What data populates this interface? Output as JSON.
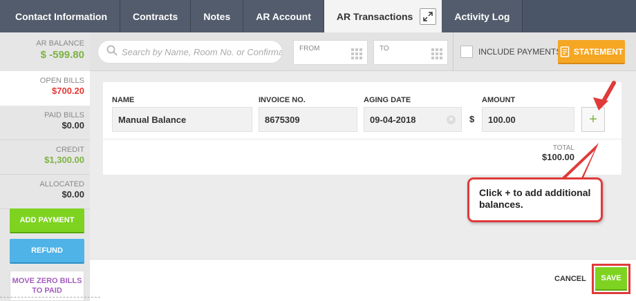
{
  "tabs": [
    {
      "label": "Contact Information"
    },
    {
      "label": "Contracts"
    },
    {
      "label": "Notes"
    },
    {
      "label": "AR Account"
    },
    {
      "label": "AR Transactions"
    },
    {
      "label": "Activity Log"
    }
  ],
  "sidebar": {
    "ar_balance_label": "AR BALANCE",
    "ar_balance_value": "$ -599.80",
    "stats": [
      {
        "label": "OPEN BILLS",
        "value": "$700.20"
      },
      {
        "label": "PAID BILLS",
        "value": "$0.00"
      },
      {
        "label": "CREDIT",
        "value": "$1,300.00"
      },
      {
        "label": "ALLOCATED",
        "value": "$0.00"
      }
    ],
    "add_payment_label": "ADD PAYMENT",
    "refund_label": "REFUND",
    "move_zero_label": "MOVE ZERO BILLS TO PAID"
  },
  "filters": {
    "search_placeholder": "Search by Name, Room No. or Confirma",
    "from_label": "FROM",
    "to_label": "TO",
    "include_payments_label": "INCLUDE PAYMENTS",
    "statement_label": "STATEMENT"
  },
  "entry": {
    "name_header": "NAME",
    "invoice_header": "INVOICE NO.",
    "aging_header": "AGING DATE",
    "amount_header": "AMOUNT",
    "name_value": "Manual Balance",
    "invoice_value": "8675309",
    "aging_value": "09-04-2018",
    "currency_symbol": "$",
    "amount_value": "100.00",
    "add_symbol": "+",
    "total_label": "TOTAL",
    "total_value": "$100.00"
  },
  "callout": {
    "text": "Click + to add additional balances."
  },
  "footer": {
    "cancel_label": "CANCEL",
    "save_label": "SAVE"
  },
  "colors": {
    "tab_bar": "#4a5568",
    "green": "#7ed321",
    "orange": "#f5a623",
    "blue": "#4fb3e8",
    "red_highlight": "#e03a3a"
  }
}
